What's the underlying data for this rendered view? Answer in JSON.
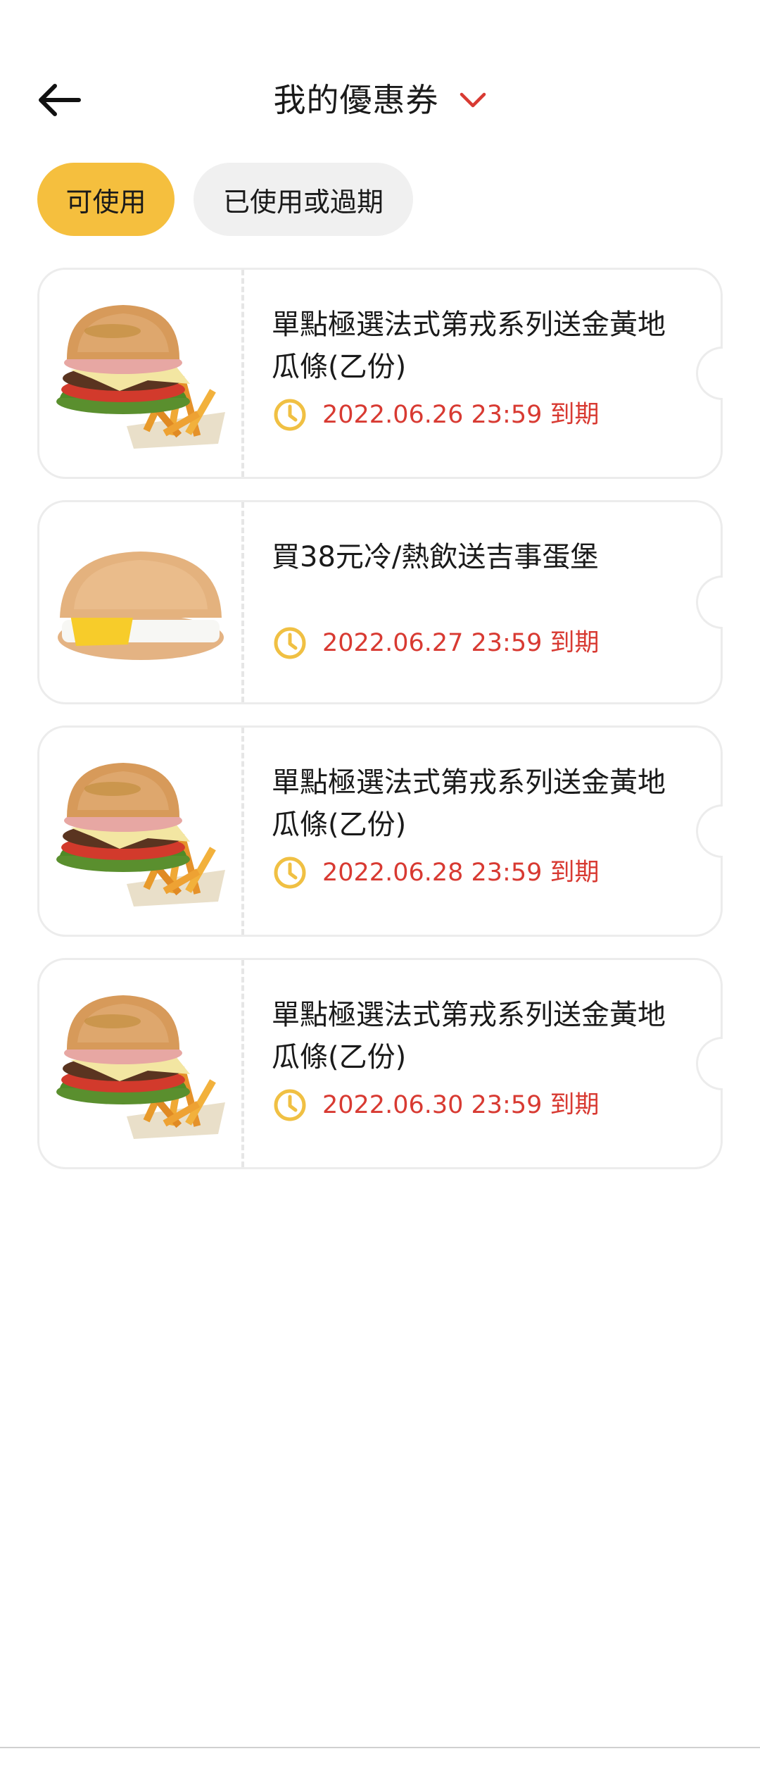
{
  "header": {
    "title": "我的優惠券",
    "back_icon": "arrow-left-icon",
    "dropdown_icon": "chevron-down-icon",
    "accent_color": "#d83a32"
  },
  "filters": {
    "active_label": "可使用",
    "inactive_label": "已使用或過期",
    "active_color": "#f5bf3e",
    "inactive_color": "#f0f0f0"
  },
  "coupons": [
    {
      "title": "單點極選法式第戎系列送金黃地瓜條(乙份)",
      "expiry": "2022.06.26 23:59 到期",
      "image": "burger-with-fries"
    },
    {
      "title": "買38元冷/熱飲送吉事蛋堡",
      "expiry": "2022.06.27 23:59 到期",
      "image": "egg-cheese-burger"
    },
    {
      "title": "單點極選法式第戎系列送金黃地瓜條(乙份)",
      "expiry": "2022.06.28 23:59 到期",
      "image": "burger-with-fries"
    },
    {
      "title": "單點極選法式第戎系列送金黃地瓜條(乙份)",
      "expiry": "2022.06.30 23:59 到期",
      "image": "burger-with-fries"
    }
  ],
  "expiry_color": "#d83a32",
  "clock_color": "#f0c043"
}
